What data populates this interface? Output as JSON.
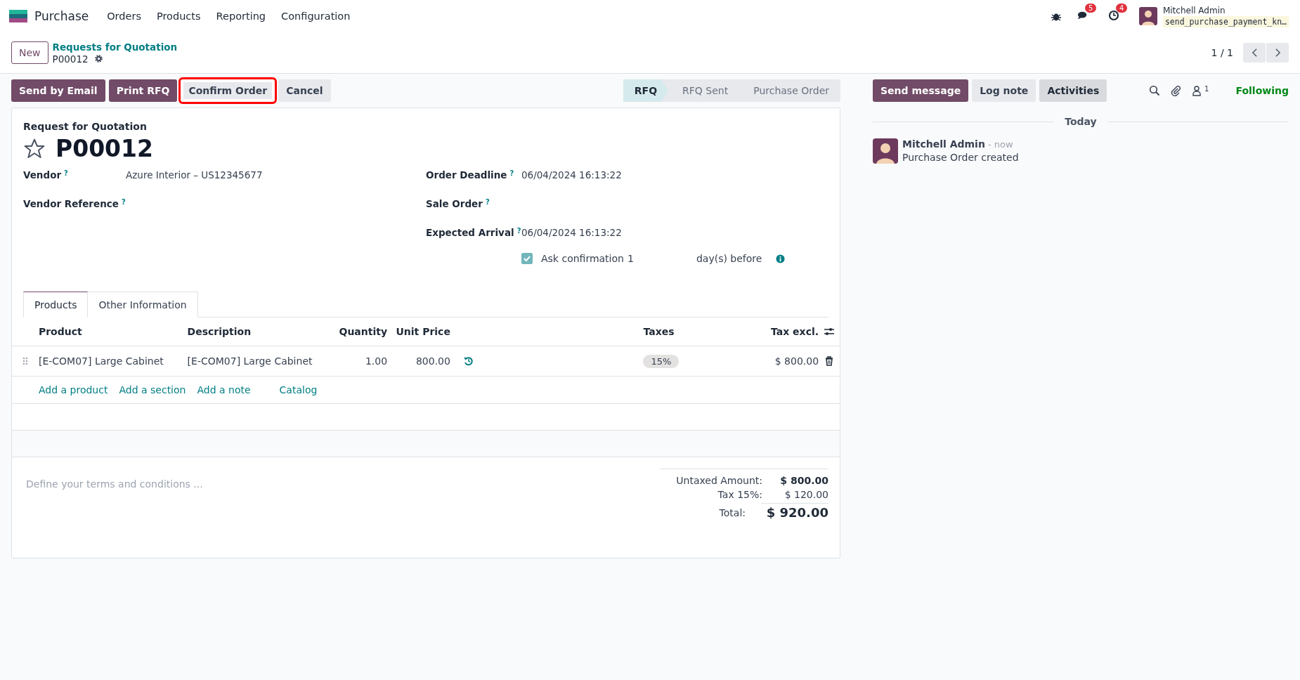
{
  "navbar": {
    "app_name": "Purchase",
    "menu": [
      "Orders",
      "Products",
      "Reporting",
      "Configuration"
    ],
    "messages_count": "5",
    "activities_count": "4",
    "user_name": "Mitchell Admin",
    "database": "send_purchase_payment_kn…"
  },
  "breadcrumb": {
    "new_button": "New",
    "parent": "Requests for Quotation",
    "current": "P00012"
  },
  "pager": {
    "value": "1 / 1"
  },
  "actions": [
    {
      "label": "Send by Email",
      "kind": "primary",
      "highlighted": false
    },
    {
      "label": "Print RFQ",
      "kind": "primary",
      "highlighted": false
    },
    {
      "label": "Confirm Order",
      "kind": "secondary",
      "highlighted": true
    },
    {
      "label": "Cancel",
      "kind": "secondary",
      "highlighted": false
    }
  ],
  "statusbar": [
    {
      "label": "RFQ",
      "selected": true
    },
    {
      "label": "RFQ Sent",
      "selected": false
    },
    {
      "label": "Purchase Order",
      "selected": false
    }
  ],
  "form": {
    "subtitle": "Request for Quotation",
    "title": "P00012",
    "starred": false,
    "left_fields": [
      {
        "label": "Vendor",
        "help": "?",
        "value": "Azure Interior – US12345677"
      },
      {
        "label": "Vendor Reference",
        "help": "?"
      }
    ],
    "right_fields": [
      {
        "label": "Order Deadline",
        "help": "?",
        "value": "06/04/2024 16:13:22"
      },
      {
        "label": "Sale Order",
        "help": "?"
      },
      {
        "label": "Expected Arrival",
        "help": "?",
        "value": "06/04/2024 16:13:22"
      }
    ],
    "ask_confirmation": {
      "checked": true,
      "label": "Ask confirmation",
      "days": "1",
      "suffix": "day(s) before"
    },
    "tabs": [
      {
        "label": "Products",
        "selected": true
      },
      {
        "label": "Other Information",
        "selected": false
      }
    ],
    "table": {
      "columns": [
        "Product",
        "Description",
        "Quantity",
        "Unit Price",
        "Taxes",
        "Tax excl."
      ],
      "rows": [
        {
          "product": "[E-COM07] Large Cabinet",
          "description": "[E-COM07] Large Cabinet",
          "quantity": "1.00",
          "unit_price": "800.00",
          "tax": "15%",
          "subtotal": "$ 800.00"
        }
      ],
      "add_links": [
        "Add a product",
        "Add a section",
        "Add a note",
        "Catalog"
      ]
    },
    "terms_placeholder": "Define your terms and conditions ...",
    "totals": [
      {
        "label": "Untaxed Amount:",
        "value": "$ 800.00",
        "kind": "bold"
      },
      {
        "label": "Tax 15%:",
        "value": "$ 120.00",
        "kind": "plain"
      },
      {
        "label": "Total:",
        "value": "$ 920.00",
        "kind": "total"
      }
    ]
  },
  "chatter": {
    "buttons": [
      {
        "label": "Send message",
        "kind": "primary"
      },
      {
        "label": "Log note",
        "kind": "secondary"
      },
      {
        "label": "Activities",
        "kind": "active"
      }
    ],
    "followers_count": "1",
    "follow_label": "Following",
    "date_separator": "Today",
    "messages": [
      {
        "author": "Mitchell Admin",
        "time": "- now",
        "body": "Purchase Order created"
      }
    ]
  }
}
